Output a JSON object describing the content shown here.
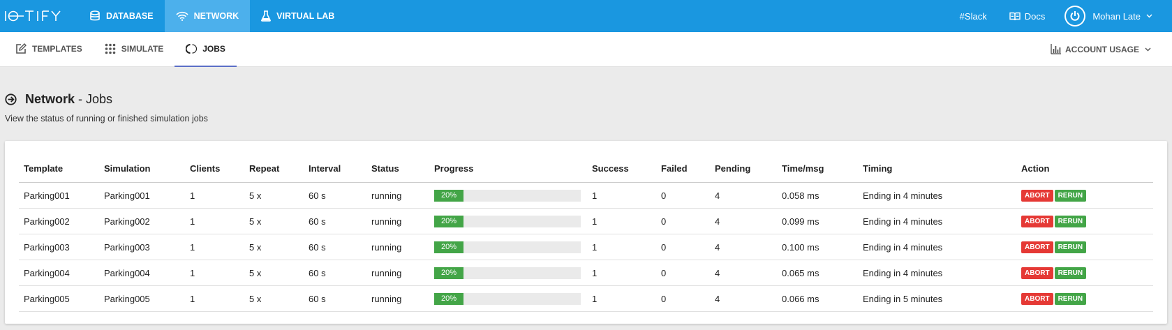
{
  "app": {
    "logo": "I⊂TIFY"
  },
  "topnav": [
    {
      "label": "Database",
      "icon": "database-icon"
    },
    {
      "label": "Network",
      "icon": "wifi-icon",
      "active": true
    },
    {
      "label": "Virtual Lab",
      "icon": "flask-icon"
    }
  ],
  "topright": {
    "slack": "#Slack",
    "docs": "Docs",
    "user": "Mohan Late"
  },
  "subnav": [
    {
      "label": "Templates",
      "icon": "edit-icon"
    },
    {
      "label": "Simulate",
      "icon": "grid-icon"
    },
    {
      "label": "Jobs",
      "icon": "spinner-icon",
      "active": true
    }
  ],
  "usage": {
    "label": "Account Usage",
    "icon": "bar-chart-icon"
  },
  "page": {
    "title_bold": "Network",
    "title_rest": " - Jobs",
    "subtitle": "View the status of running or finished simulation jobs"
  },
  "table": {
    "headers": [
      "Template",
      "Simulation",
      "Clients",
      "Repeat",
      "Interval",
      "Status",
      "Progress",
      "Success",
      "Failed",
      "Pending",
      "Time/msg",
      "Timing",
      "Action"
    ],
    "rows": [
      {
        "template": "Parking001",
        "simulation": "Parking001",
        "clients": "1",
        "repeat": "5 x",
        "interval": "60 s",
        "status": "running",
        "progress": 0.2,
        "progress_label": "20%",
        "success": "1",
        "failed": "0",
        "pending": "4",
        "time_msg": "0.058 ms",
        "timing": "Ending in 4 minutes"
      },
      {
        "template": "Parking002",
        "simulation": "Parking002",
        "clients": "1",
        "repeat": "5 x",
        "interval": "60 s",
        "status": "running",
        "progress": 0.2,
        "progress_label": "20%",
        "success": "1",
        "failed": "0",
        "pending": "4",
        "time_msg": "0.099 ms",
        "timing": "Ending in 4 minutes"
      },
      {
        "template": "Parking003",
        "simulation": "Parking003",
        "clients": "1",
        "repeat": "5 x",
        "interval": "60 s",
        "status": "running",
        "progress": 0.2,
        "progress_label": "20%",
        "success": "1",
        "failed": "0",
        "pending": "4",
        "time_msg": "0.100 ms",
        "timing": "Ending in 4 minutes"
      },
      {
        "template": "Parking004",
        "simulation": "Parking004",
        "clients": "1",
        "repeat": "5 x",
        "interval": "60 s",
        "status": "running",
        "progress": 0.2,
        "progress_label": "20%",
        "success": "1",
        "failed": "0",
        "pending": "4",
        "time_msg": "0.065 ms",
        "timing": "Ending in 4 minutes"
      },
      {
        "template": "Parking005",
        "simulation": "Parking005",
        "clients": "1",
        "repeat": "5 x",
        "interval": "60 s",
        "status": "running",
        "progress": 0.2,
        "progress_label": "20%",
        "success": "1",
        "failed": "0",
        "pending": "4",
        "time_msg": "0.066 ms",
        "timing": "Ending in 5 minutes"
      }
    ],
    "actions": {
      "abort": "Abort",
      "rerun": "Rerun"
    }
  },
  "colors": {
    "topbar": "#1a97e0",
    "active_tab": "#4cb0ec",
    "success": "#43a547",
    "danger": "#e53935",
    "tab_underline": "#5b6fc7"
  }
}
